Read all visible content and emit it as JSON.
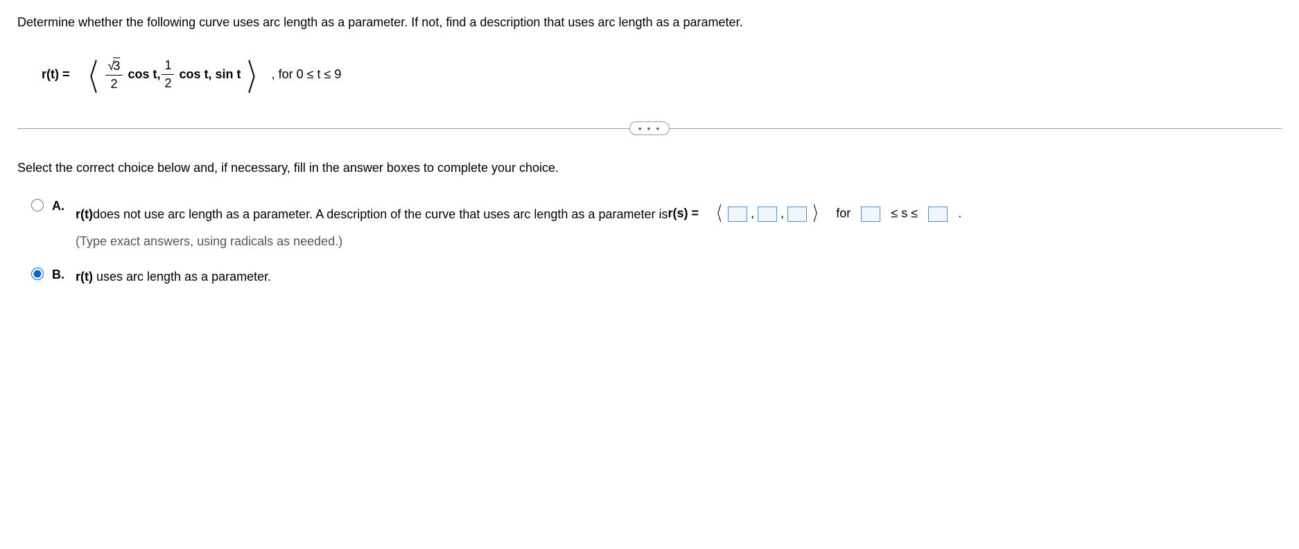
{
  "question": "Determine whether the following curve uses arc length as a parameter. If not, find a description that uses arc length as a parameter.",
  "equation": {
    "lhs": "r(t) =",
    "frac1_num_rad": "3",
    "frac1_den": "2",
    "cos1": "cos t,",
    "frac2_num": "1",
    "frac2_den": "2",
    "cos2": "cos t,",
    "sin": "sin t",
    "domain": ", for 0 ≤ t ≤ 9"
  },
  "divider_label": "• • •",
  "prompt": "Select the correct choice below and, if necessary, fill in the answer boxes to complete your choice.",
  "choiceA": {
    "letter": "A.",
    "part1_prefix": "r(t)",
    "part1_rest": " does not use arc length as a parameter. A description of the curve that uses arc length as a parameter is ",
    "rs": "r(s) =",
    "for": "for",
    "ineq": "≤ s ≤",
    "period": ".",
    "hint": "(Type exact answers, using radicals as needed.)"
  },
  "choiceB": {
    "letter": "B.",
    "prefix": "r(t)",
    "rest": " uses arc length as a parameter."
  }
}
